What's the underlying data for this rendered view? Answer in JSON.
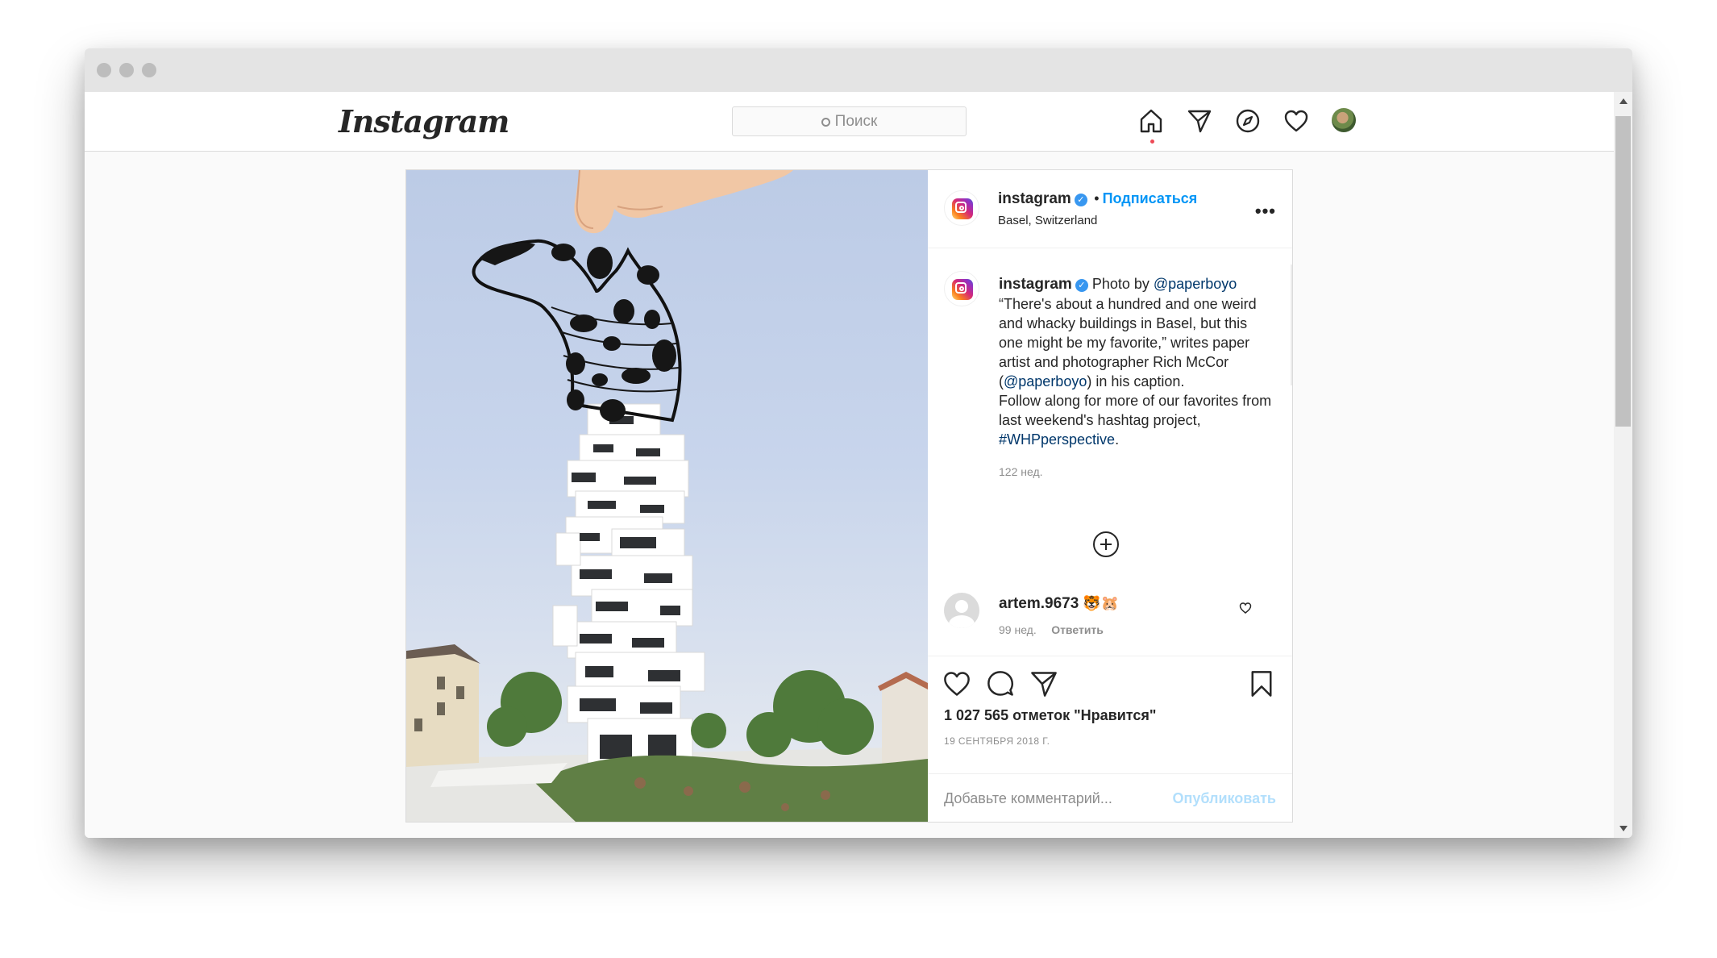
{
  "nav": {
    "logo": "Instagram",
    "search_placeholder": "Поиск"
  },
  "post": {
    "author": "instagram",
    "follow_label": "Подписаться",
    "location": "Basel, Switzerland",
    "more_label": "•••",
    "caption": {
      "author": "instagram",
      "prefix": "Photo by ",
      "mention": "@paperboyo",
      "text1": "“There's about a hundred and one weird and whacky buildings in Basel, but this one might be my favorite,” writes paper artist and photographer Rich McCor (",
      "mention2": "@paperboyo",
      "text2": ") in his caption.",
      "text3": "Follow along for more of our favorites from last weekend's hashtag project, ",
      "hashtag": "#WHPperspective",
      "text4": ".",
      "time": "122 нед."
    },
    "comment": {
      "author": "artem.9673",
      "emoji": "🐯🐹",
      "time": "99 нед.",
      "reply_label": "Ответить"
    },
    "likes": "1 027 565 отметок \"Нравится\"",
    "date": "19 СЕНТЯБРЯ 2018 Г.",
    "comment_placeholder": "Добавьте комментарий...",
    "publish_label": "Опубликовать"
  },
  "colors": {
    "accent": "#0095f6",
    "link": "#00376b",
    "notification_dot": "#ed4956",
    "publish_disabled": "#b2dffc"
  },
  "icons": [
    "home-icon",
    "direct-icon",
    "explore-icon",
    "activity-heart-icon",
    "verified-icon",
    "more-icon",
    "add-circle-icon",
    "like-icon",
    "comment-icon",
    "share-icon",
    "save-icon",
    "comment-like-icon"
  ]
}
